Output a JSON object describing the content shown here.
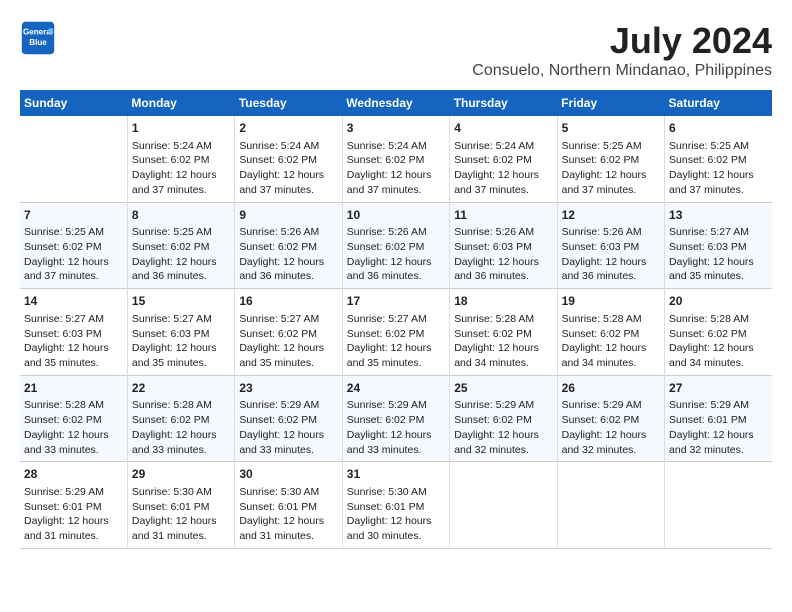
{
  "header": {
    "logo_line1": "General",
    "logo_line2": "Blue",
    "title": "July 2024",
    "subtitle": "Consuelo, Northern Mindanao, Philippines"
  },
  "columns": [
    "Sunday",
    "Monday",
    "Tuesday",
    "Wednesday",
    "Thursday",
    "Friday",
    "Saturday"
  ],
  "weeks": [
    [
      {
        "day": "",
        "sunrise": "",
        "sunset": "",
        "daylight": ""
      },
      {
        "day": "1",
        "sunrise": "Sunrise: 5:24 AM",
        "sunset": "Sunset: 6:02 PM",
        "daylight": "Daylight: 12 hours and 37 minutes."
      },
      {
        "day": "2",
        "sunrise": "Sunrise: 5:24 AM",
        "sunset": "Sunset: 6:02 PM",
        "daylight": "Daylight: 12 hours and 37 minutes."
      },
      {
        "day": "3",
        "sunrise": "Sunrise: 5:24 AM",
        "sunset": "Sunset: 6:02 PM",
        "daylight": "Daylight: 12 hours and 37 minutes."
      },
      {
        "day": "4",
        "sunrise": "Sunrise: 5:24 AM",
        "sunset": "Sunset: 6:02 PM",
        "daylight": "Daylight: 12 hours and 37 minutes."
      },
      {
        "day": "5",
        "sunrise": "Sunrise: 5:25 AM",
        "sunset": "Sunset: 6:02 PM",
        "daylight": "Daylight: 12 hours and 37 minutes."
      },
      {
        "day": "6",
        "sunrise": "Sunrise: 5:25 AM",
        "sunset": "Sunset: 6:02 PM",
        "daylight": "Daylight: 12 hours and 37 minutes."
      }
    ],
    [
      {
        "day": "7",
        "sunrise": "Sunrise: 5:25 AM",
        "sunset": "Sunset: 6:02 PM",
        "daylight": "Daylight: 12 hours and 37 minutes."
      },
      {
        "day": "8",
        "sunrise": "Sunrise: 5:25 AM",
        "sunset": "Sunset: 6:02 PM",
        "daylight": "Daylight: 12 hours and 36 minutes."
      },
      {
        "day": "9",
        "sunrise": "Sunrise: 5:26 AM",
        "sunset": "Sunset: 6:02 PM",
        "daylight": "Daylight: 12 hours and 36 minutes."
      },
      {
        "day": "10",
        "sunrise": "Sunrise: 5:26 AM",
        "sunset": "Sunset: 6:02 PM",
        "daylight": "Daylight: 12 hours and 36 minutes."
      },
      {
        "day": "11",
        "sunrise": "Sunrise: 5:26 AM",
        "sunset": "Sunset: 6:03 PM",
        "daylight": "Daylight: 12 hours and 36 minutes."
      },
      {
        "day": "12",
        "sunrise": "Sunrise: 5:26 AM",
        "sunset": "Sunset: 6:03 PM",
        "daylight": "Daylight: 12 hours and 36 minutes."
      },
      {
        "day": "13",
        "sunrise": "Sunrise: 5:27 AM",
        "sunset": "Sunset: 6:03 PM",
        "daylight": "Daylight: 12 hours and 35 minutes."
      }
    ],
    [
      {
        "day": "14",
        "sunrise": "Sunrise: 5:27 AM",
        "sunset": "Sunset: 6:03 PM",
        "daylight": "Daylight: 12 hours and 35 minutes."
      },
      {
        "day": "15",
        "sunrise": "Sunrise: 5:27 AM",
        "sunset": "Sunset: 6:03 PM",
        "daylight": "Daylight: 12 hours and 35 minutes."
      },
      {
        "day": "16",
        "sunrise": "Sunrise: 5:27 AM",
        "sunset": "Sunset: 6:02 PM",
        "daylight": "Daylight: 12 hours and 35 minutes."
      },
      {
        "day": "17",
        "sunrise": "Sunrise: 5:27 AM",
        "sunset": "Sunset: 6:02 PM",
        "daylight": "Daylight: 12 hours and 35 minutes."
      },
      {
        "day": "18",
        "sunrise": "Sunrise: 5:28 AM",
        "sunset": "Sunset: 6:02 PM",
        "daylight": "Daylight: 12 hours and 34 minutes."
      },
      {
        "day": "19",
        "sunrise": "Sunrise: 5:28 AM",
        "sunset": "Sunset: 6:02 PM",
        "daylight": "Daylight: 12 hours and 34 minutes."
      },
      {
        "day": "20",
        "sunrise": "Sunrise: 5:28 AM",
        "sunset": "Sunset: 6:02 PM",
        "daylight": "Daylight: 12 hours and 34 minutes."
      }
    ],
    [
      {
        "day": "21",
        "sunrise": "Sunrise: 5:28 AM",
        "sunset": "Sunset: 6:02 PM",
        "daylight": "Daylight: 12 hours and 33 minutes."
      },
      {
        "day": "22",
        "sunrise": "Sunrise: 5:28 AM",
        "sunset": "Sunset: 6:02 PM",
        "daylight": "Daylight: 12 hours and 33 minutes."
      },
      {
        "day": "23",
        "sunrise": "Sunrise: 5:29 AM",
        "sunset": "Sunset: 6:02 PM",
        "daylight": "Daylight: 12 hours and 33 minutes."
      },
      {
        "day": "24",
        "sunrise": "Sunrise: 5:29 AM",
        "sunset": "Sunset: 6:02 PM",
        "daylight": "Daylight: 12 hours and 33 minutes."
      },
      {
        "day": "25",
        "sunrise": "Sunrise: 5:29 AM",
        "sunset": "Sunset: 6:02 PM",
        "daylight": "Daylight: 12 hours and 32 minutes."
      },
      {
        "day": "26",
        "sunrise": "Sunrise: 5:29 AM",
        "sunset": "Sunset: 6:02 PM",
        "daylight": "Daylight: 12 hours and 32 minutes."
      },
      {
        "day": "27",
        "sunrise": "Sunrise: 5:29 AM",
        "sunset": "Sunset: 6:01 PM",
        "daylight": "Daylight: 12 hours and 32 minutes."
      }
    ],
    [
      {
        "day": "28",
        "sunrise": "Sunrise: 5:29 AM",
        "sunset": "Sunset: 6:01 PM",
        "daylight": "Daylight: 12 hours and 31 minutes."
      },
      {
        "day": "29",
        "sunrise": "Sunrise: 5:30 AM",
        "sunset": "Sunset: 6:01 PM",
        "daylight": "Daylight: 12 hours and 31 minutes."
      },
      {
        "day": "30",
        "sunrise": "Sunrise: 5:30 AM",
        "sunset": "Sunset: 6:01 PM",
        "daylight": "Daylight: 12 hours and 31 minutes."
      },
      {
        "day": "31",
        "sunrise": "Sunrise: 5:30 AM",
        "sunset": "Sunset: 6:01 PM",
        "daylight": "Daylight: 12 hours and 30 minutes."
      },
      {
        "day": "",
        "sunrise": "",
        "sunset": "",
        "daylight": ""
      },
      {
        "day": "",
        "sunrise": "",
        "sunset": "",
        "daylight": ""
      },
      {
        "day": "",
        "sunrise": "",
        "sunset": "",
        "daylight": ""
      }
    ]
  ]
}
